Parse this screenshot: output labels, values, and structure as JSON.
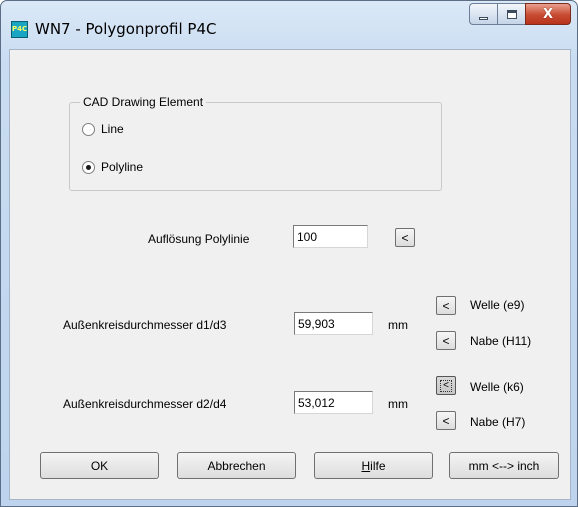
{
  "window": {
    "icon_text": "P4C",
    "title": "WN7  -  Polygonprofil P4C",
    "close_glyph": "X"
  },
  "cad_group": {
    "legend": "CAD Drawing Element",
    "options": [
      {
        "label": "Line",
        "checked": false
      },
      {
        "label": "Polyline",
        "checked": true
      }
    ]
  },
  "resolution": {
    "label": "Auflösung Polylinie",
    "value": "100",
    "button": "<"
  },
  "d1d3": {
    "label": "Außenkreisdurchmesser d1/d3",
    "value": "59,903",
    "unit": "mm",
    "welle_btn": "<",
    "welle_label": "Welle (e9)",
    "nabe_btn": "<",
    "nabe_label": "Nabe (H11)"
  },
  "d2d4": {
    "label": "Außenkreisdurchmesser d2/d4",
    "value": "53,012",
    "unit": "mm",
    "welle_btn": "<",
    "welle_label": "Welle (k6)",
    "nabe_btn": "<",
    "nabe_label": "Nabe (H7)"
  },
  "buttons": {
    "ok": "OK",
    "cancel": "Abbrechen",
    "help_prefix": "",
    "help_mnemonic": "H",
    "help_rest": "ilfe",
    "units": "mm <--> inch"
  }
}
